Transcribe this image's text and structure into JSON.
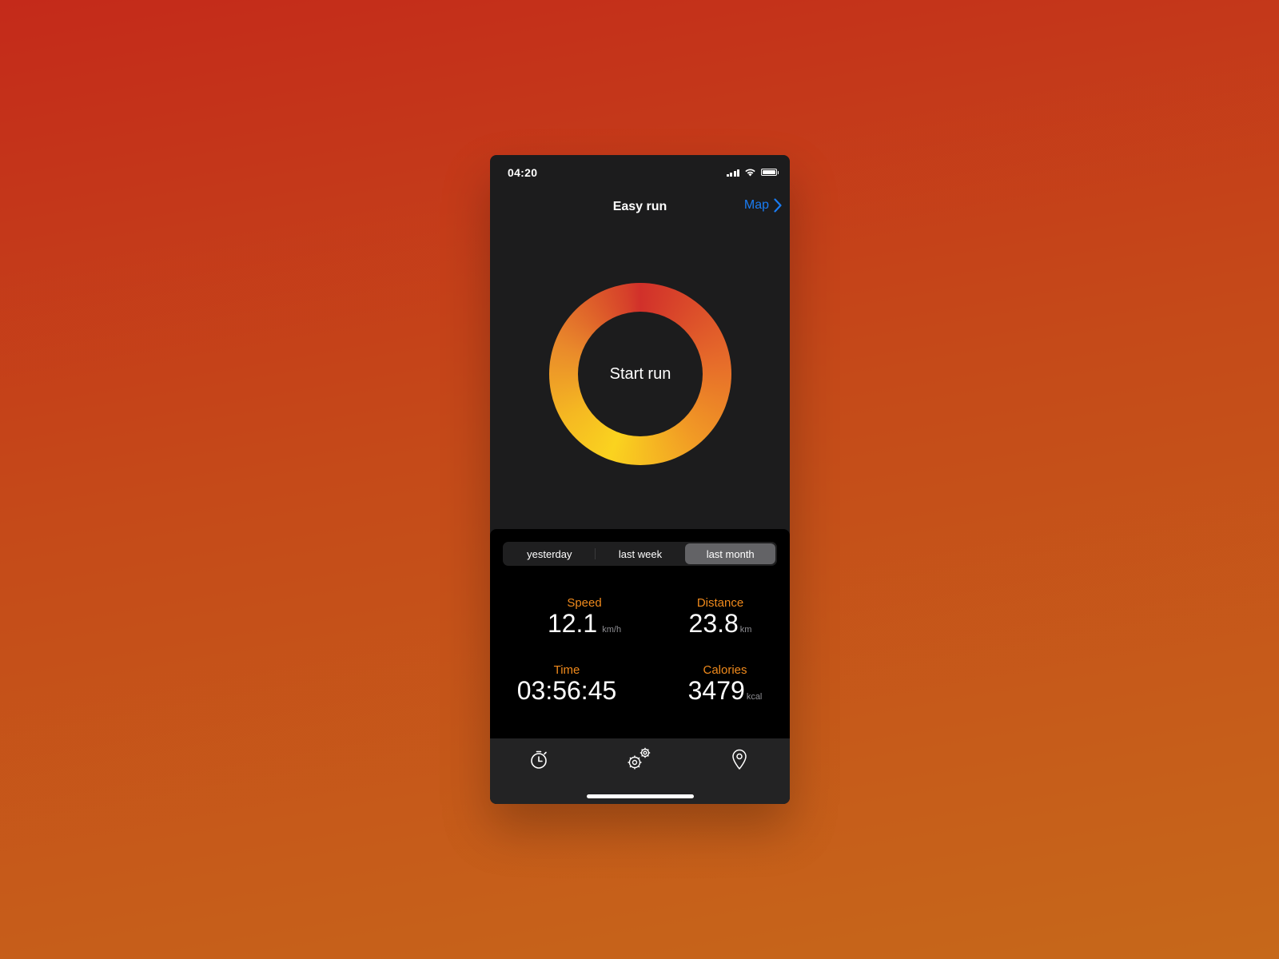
{
  "status_bar": {
    "time": "04:20",
    "icons": [
      "signal-icon",
      "wifi-icon",
      "battery-icon"
    ]
  },
  "nav": {
    "title": "Easy run",
    "map_label": "Map",
    "map_icon": "chevron-right-icon"
  },
  "ring": {
    "label": "Start run"
  },
  "period_tabs": [
    {
      "label": "yesterday",
      "selected": false
    },
    {
      "label": "last week",
      "selected": false
    },
    {
      "label": "last month",
      "selected": true
    }
  ],
  "stats": {
    "speed": {
      "label": "Speed",
      "value": "12.1",
      "unit": "km/h"
    },
    "distance": {
      "label": "Distance",
      "value": "23.8",
      "unit": "km"
    },
    "time": {
      "label": "Time",
      "value": "03:56:45",
      "unit": ""
    },
    "calories": {
      "label": "Calories",
      "value": "3479",
      "unit": "kcal"
    }
  },
  "tab_bar": {
    "items": [
      "stopwatch-icon",
      "settings-gears-icon",
      "location-pin-icon"
    ]
  },
  "colors": {
    "accent_blue": "#1a7cf2",
    "stat_label_orange": "#f08a1c",
    "ring_red": "#d1302a",
    "ring_yellow": "#fad31f"
  }
}
